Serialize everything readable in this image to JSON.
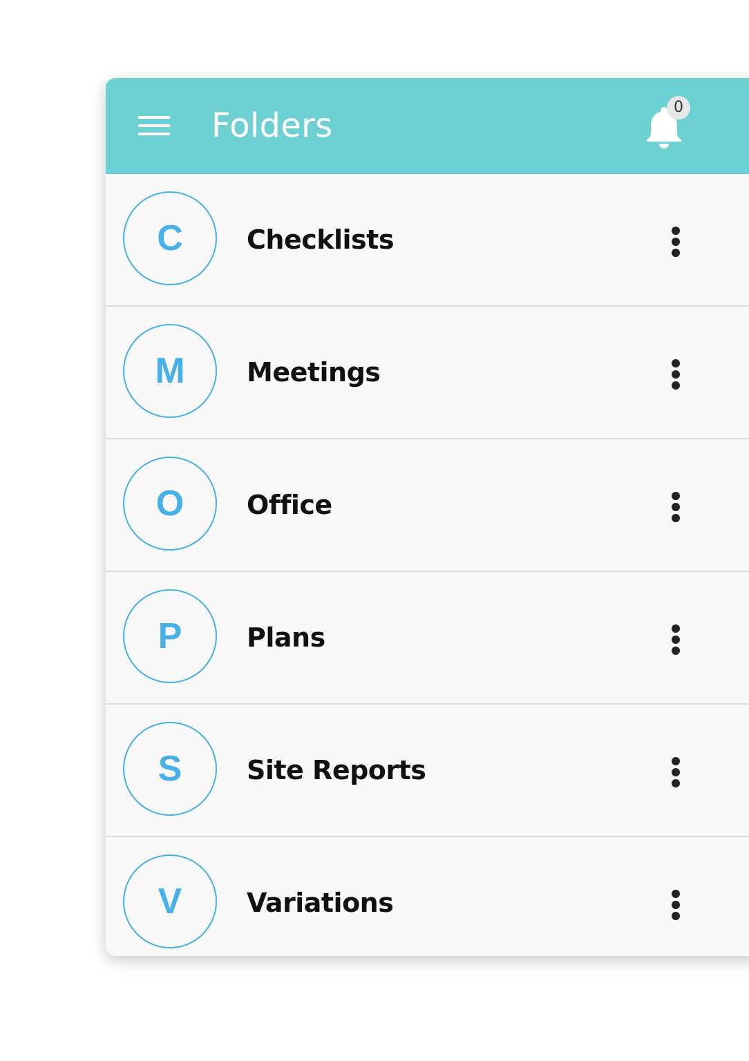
{
  "colors": {
    "accent": "#6dd1d4",
    "avatar": "#48b0e8"
  },
  "header": {
    "title": "Folders",
    "menu_icon": "hamburger-menu-icon",
    "notifications_icon": "bell-icon",
    "notification_count": "0"
  },
  "folders": [
    {
      "initial": "C",
      "name": "Checklists",
      "more_icon": "more-vertical-icon"
    },
    {
      "initial": "M",
      "name": "Meetings",
      "more_icon": "more-vertical-icon"
    },
    {
      "initial": "O",
      "name": "Office",
      "more_icon": "more-vertical-icon"
    },
    {
      "initial": "P",
      "name": "Plans",
      "more_icon": "more-vertical-icon"
    },
    {
      "initial": "S",
      "name": "Site Reports",
      "more_icon": "more-vertical-icon"
    },
    {
      "initial": "V",
      "name": "Variations",
      "more_icon": "more-vertical-icon"
    }
  ]
}
